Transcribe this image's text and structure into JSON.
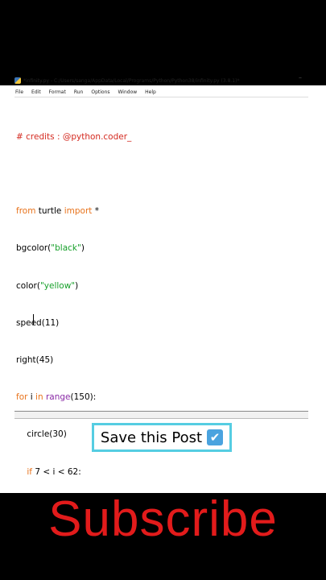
{
  "window": {
    "title": "*infinity.py - C:/Users/sanga/AppData/Local/Programs/Python/Python38/infinity.py (3.8.1)*",
    "minimize_glyph": "–"
  },
  "menu": [
    "File",
    "Edit",
    "Format",
    "Run",
    "Options",
    "Window",
    "Help"
  ],
  "code": {
    "comment": "# credits : @python.coder_",
    "line_import": {
      "kw1": "from",
      "mod": " turtle ",
      "kw2": "import",
      "rest": " *"
    },
    "line_bgcolor": {
      "fn": "bgcolor(",
      "str": "\"black\"",
      "end": ")"
    },
    "line_color": {
      "fn": "color(",
      "str": "\"yellow\"",
      "end": ")"
    },
    "line_speed": "speed(11)",
    "line_right": "right(45)",
    "line_for": {
      "kw1": "for",
      "mid": " i ",
      "kw2": "in",
      "sp": " ",
      "builtin": "range",
      "end": "(150):"
    },
    "line_circle": "    circle(30)",
    "line_if": {
      "indent": "    ",
      "kw": "if",
      "rest": " 7 < i < 62:"
    }
  },
  "overlay": {
    "save_text": "Save this Post",
    "save_emoji": "✔",
    "subscribe_text": "Subscribe"
  },
  "colors": {
    "comment": "#d42a20",
    "keyword": "#e8731c",
    "string": "#17a02a",
    "builtin": "#8a2aa6",
    "subscribe": "#e21b1b",
    "save_border": "#55cde2"
  }
}
